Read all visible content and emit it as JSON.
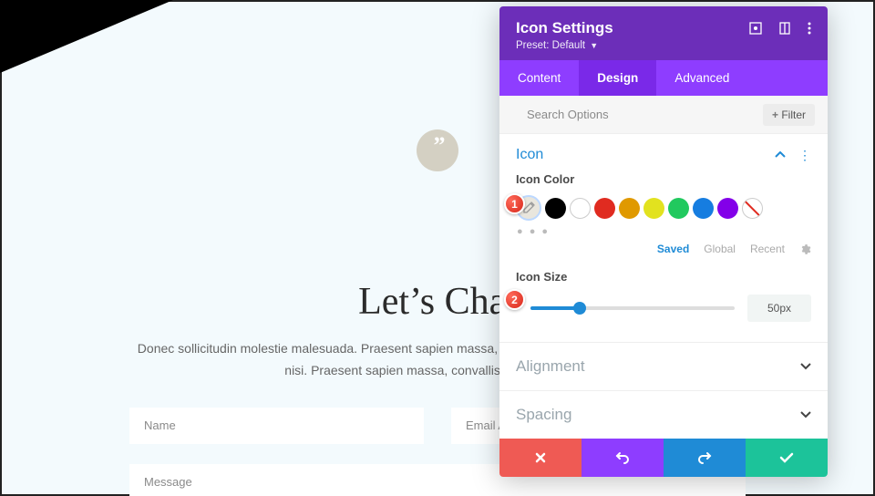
{
  "chat": {
    "heading": "Let’s Chat",
    "body": "Donec sollicitudin molestie malesuada. Praesent sapien massa, convallis a pellentesque nec, egestas non nisi. Praesent sapien massa, convallis a pellentesque.",
    "name_ph": "Name",
    "email_ph": "Email Address",
    "message_ph": "Message"
  },
  "panel": {
    "title": "Icon Settings",
    "preset_label": "Preset:",
    "preset_value": "Default",
    "tabs": {
      "content": "Content",
      "design": "Design",
      "advanced": "Advanced"
    },
    "search_ph": "Search Options",
    "filter_label": "Filter",
    "icon_section": "Icon",
    "icon_color_label": "Icon Color",
    "swatch_tabs": {
      "saved": "Saved",
      "global": "Global",
      "recent": "Recent"
    },
    "icon_size_label": "Icon Size",
    "icon_size_value": "50px",
    "acc": {
      "alignment": "Alignment",
      "spacing": "Spacing"
    }
  },
  "badges": {
    "one": "1",
    "two": "2"
  },
  "colors": {
    "accent_purple": "#8e3dff",
    "accent_blue": "#1f8bd6",
    "cancel": "#ef5a54",
    "ok": "#1cc39a"
  }
}
